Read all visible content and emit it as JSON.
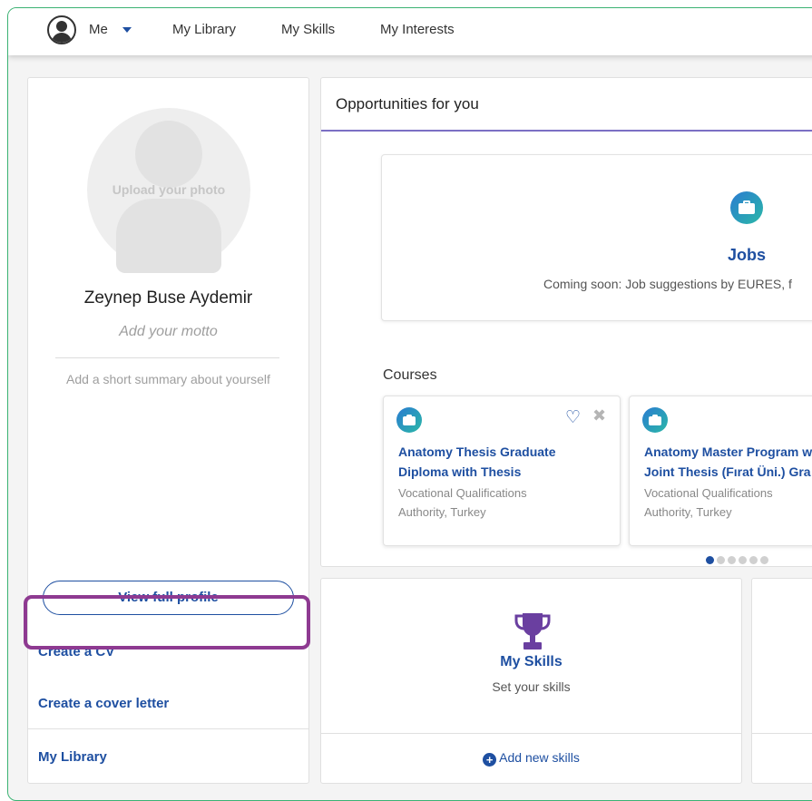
{
  "nav": {
    "me_label": "Me",
    "links": [
      "My Library",
      "My Skills",
      "My Interests"
    ]
  },
  "profile": {
    "upload_photo": "Upload your photo",
    "name": "Zeynep Buse Aydemir",
    "motto_placeholder": "Add your motto",
    "summary_placeholder": "Add a short summary about yourself",
    "view_full_profile": "View full profile",
    "create_cv": "Create a CV",
    "create_cover_letter": "Create a cover letter",
    "my_library": "My Library"
  },
  "opportunities": {
    "title": "Opportunities for you",
    "jobs": {
      "title": "Jobs",
      "subtitle": "Coming soon: Job suggestions by EURES, f"
    },
    "courses_label": "Courses",
    "courses": [
      {
        "title_line1": "Anatomy Thesis Graduate",
        "title_line2": "Diploma with Thesis",
        "org_line1": "Vocational Qualifications",
        "org_line2": "Authority, Turkey"
      },
      {
        "title_line1": "Anatomy Master Program w",
        "title_line2": "Joint Thesis (Fırat Üni.) Gra",
        "org_line1": "Vocational Qualifications",
        "org_line2": "Authority, Turkey"
      }
    ],
    "carousel": {
      "pages": 6,
      "active_page": 1
    }
  },
  "skills_card": {
    "title": "My Skills",
    "subtitle": "Set your skills",
    "add_label": "Add new skills"
  },
  "colors": {
    "link_blue": "#1e4fa1",
    "highlight_purple": "#8e3a91",
    "trophy_purple": "#6a3fa0",
    "frame_green": "#3bb273"
  }
}
